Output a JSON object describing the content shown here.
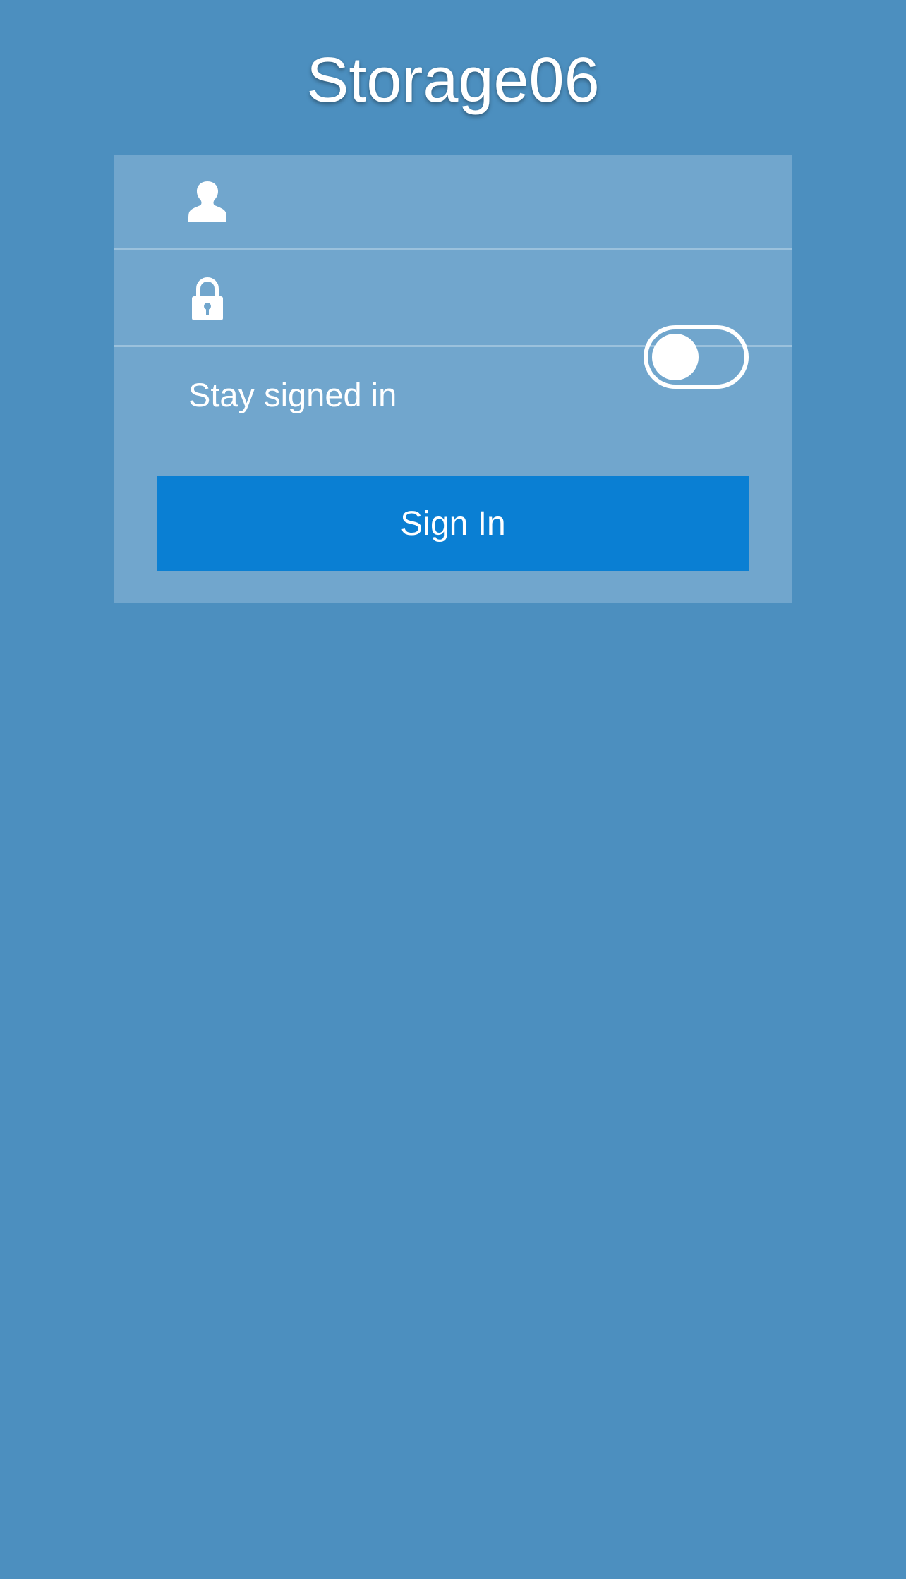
{
  "app": {
    "title": "Storage06"
  },
  "login": {
    "username": {
      "icon": "user-icon",
      "value": "",
      "placeholder": ""
    },
    "password": {
      "icon": "lock-icon",
      "value": "",
      "placeholder": ""
    },
    "stay_signed_in": {
      "label": "Stay signed in",
      "enabled": false
    },
    "sign_in_label": "Sign In"
  },
  "colors": {
    "background": "#4c8fbf",
    "panel": "#71a6cd",
    "divider": "#9bc1dc",
    "button": "#0a7fd3",
    "text": "#ffffff"
  }
}
